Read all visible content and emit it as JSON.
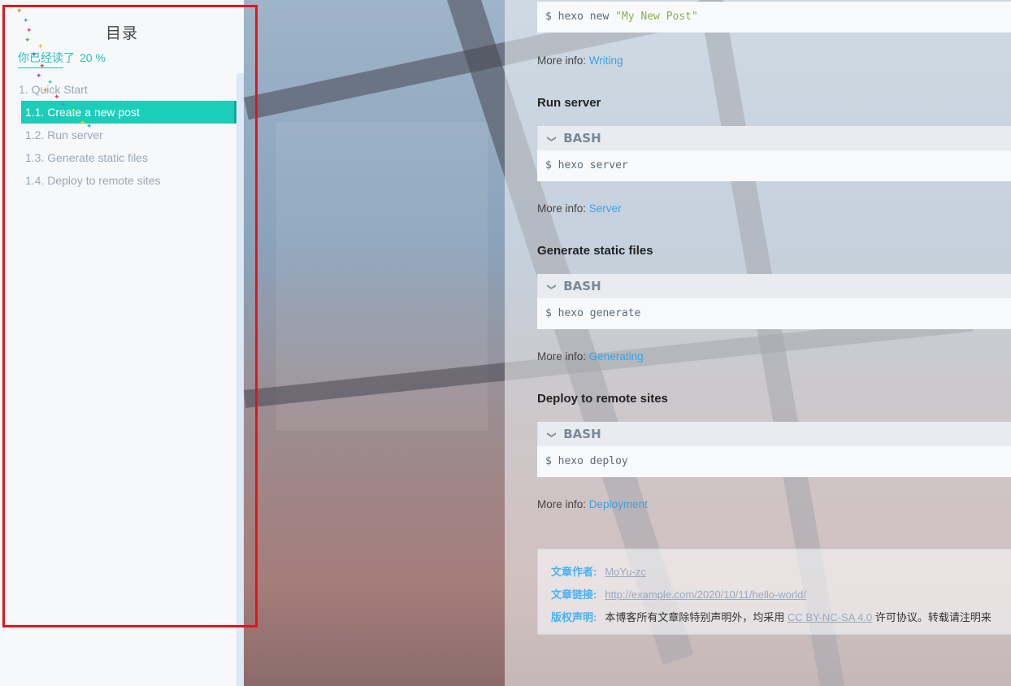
{
  "sidebar": {
    "title": "目录",
    "progress_label": "你已经读了",
    "progress_percent": "20 %",
    "progress_value": 0.2,
    "items": [
      {
        "label": "1. Quick Start",
        "level": 1,
        "active": false
      },
      {
        "label": "1.1. Create a new post",
        "level": 2,
        "active": true
      },
      {
        "label": "1.2. Run server",
        "level": 2,
        "active": false
      },
      {
        "label": "1.3. Generate static files",
        "level": 2,
        "active": false
      },
      {
        "label": "1.4. Deploy to remote sites",
        "level": 2,
        "active": false
      }
    ]
  },
  "content": {
    "top_code": {
      "prefix": "$ hexo new ",
      "string": "\"My New Post\""
    },
    "more_info_label": "More info:",
    "sections": [
      {
        "more_info_link": "Writing"
      },
      {
        "heading": "Run server",
        "lang": "BASH",
        "code": "$ hexo server",
        "more_info_link": "Server"
      },
      {
        "heading": "Generate static files",
        "lang": "BASH",
        "code": "$ hexo generate",
        "more_info_link": "Generating"
      },
      {
        "heading": "Deploy to remote sites",
        "lang": "BASH",
        "code": "$ hexo deploy",
        "more_info_link": "Deployment"
      }
    ],
    "copyright": {
      "author_label": "文章作者:",
      "author": "MoYu-zc",
      "link_label": "文章链接:",
      "link": "http://example.com/2020/10/11/hello-world/",
      "license_label": "版权声明:",
      "license_text_before": "本博客所有文章除特别声明外，均采用",
      "license_link": "CC BY-NC-SA 4.0",
      "license_text_after": "许可协议。转载请注明来"
    }
  },
  "colors": {
    "accent": "#1ccdb9",
    "link": "#3ba2e4",
    "highlight_border": "#e3141b"
  }
}
